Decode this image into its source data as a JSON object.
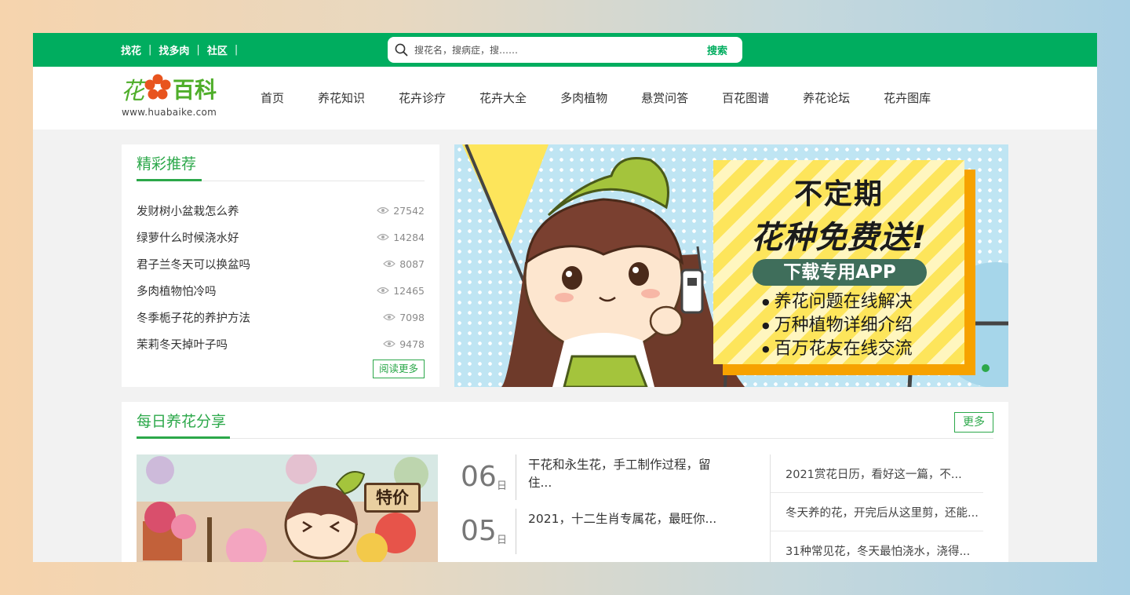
{
  "topbar": {
    "links": [
      "找花",
      "找多肉",
      "社区"
    ],
    "separator": "|",
    "search_placeholder": "搜花名，搜病症，搜……",
    "search_button": "搜索"
  },
  "logo": {
    "name_part1": "花",
    "name_part2": "百科",
    "url": "www.huabaike.com"
  },
  "nav": [
    "首页",
    "养花知识",
    "花卉诊疗",
    "花卉大全",
    "多肉植物",
    "悬赏问答",
    "百花图谱",
    "养花论坛",
    "花卉图库"
  ],
  "featured": {
    "title": "精彩推荐",
    "items": [
      {
        "title": "发财树小盆栽怎么养",
        "views": "27542"
      },
      {
        "title": "绿萝什么时候浇水好",
        "views": "14284"
      },
      {
        "title": "君子兰冬天可以换盆吗",
        "views": "8087"
      },
      {
        "title": "多肉植物怕冷吗",
        "views": "12465"
      },
      {
        "title": "冬季栀子花的养护方法",
        "views": "7098"
      },
      {
        "title": "茉莉冬天掉叶子吗",
        "views": "9478"
      }
    ],
    "read_more": "阅读更多"
  },
  "banner": {
    "line1": "不定期",
    "line2": "花种免费送!",
    "pill": "下载专用APP",
    "bullets": [
      "养花问题在线解决",
      "万种植物详细介绍",
      "百万花友在线交流"
    ]
  },
  "daily": {
    "title": "每日养花分享",
    "more": "更多",
    "photo_tag": "特价",
    "dated": [
      {
        "day": "06",
        "unit": "日",
        "title": "干花和永生花，手工制作过程，留住..."
      },
      {
        "day": "05",
        "unit": "日",
        "title": "2021，十二生肖专属花，最旺你..."
      }
    ],
    "side": [
      "2021赏花日历，看好这一篇，不...",
      "冬天养的花，开完后从这里剪，还能...",
      "31种常见花，冬天最怕浇水，浇得..."
    ]
  },
  "colors": {
    "brand_green": "#00ad5f",
    "title_green": "#2ca84a",
    "logo_flower": "#e8541e"
  }
}
